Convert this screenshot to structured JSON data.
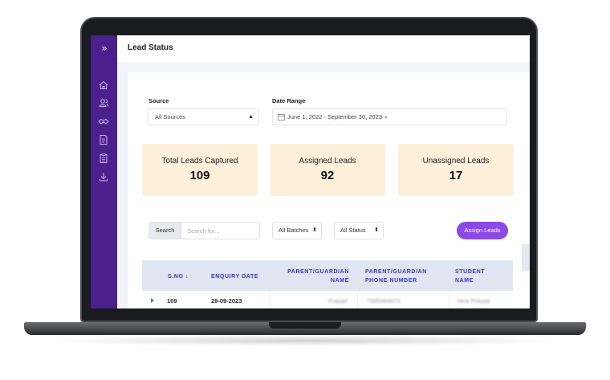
{
  "header": {
    "title": "Lead Status"
  },
  "filters": {
    "source_label": "Source",
    "source_value": "All Sources",
    "date_label": "Date Range",
    "date_value": "June 1, 2022 - September 30, 2023"
  },
  "stats": [
    {
      "label": "Total Leads Captured",
      "value": "109"
    },
    {
      "label": "Assigned Leads",
      "value": "92"
    },
    {
      "label": "Unassigned Leads",
      "value": "17"
    }
  ],
  "toolbar": {
    "search_label": "Search",
    "search_placeholder": "Search for...",
    "batch_select": "All Batches",
    "status_select": "All Status",
    "assign_label": "Assign Leads"
  },
  "table": {
    "headers": {
      "sno": "S.NO",
      "enquiry_date": "ENQUIRY DATE",
      "parent_name_1": "PARENT/GUARDIAN",
      "parent_name_2": "NAME",
      "parent_phone_1": "PARENT/GUARDIAN",
      "parent_phone_2": "PHONE NUMBER",
      "student_1": "STUDENT",
      "student_2": "NAME"
    },
    "rows": [
      {
        "sno": "109",
        "date": "29-09-2023",
        "parent": "Prasad",
        "phone": "7585464673",
        "student": "Vara Prasad"
      }
    ]
  },
  "colors": {
    "sidebar": "#4b1f8c",
    "accent": "#8b4ae6",
    "stat_bg": "#fdf0da",
    "table_head": "#dfe6f1"
  },
  "icons": [
    "sidebar-expand-icon",
    "home-icon",
    "users-icon",
    "handshake-icon",
    "document-icon",
    "clipboard-icon",
    "download-icon",
    "calendar-icon",
    "sort-down-icon",
    "expand-row-icon"
  ]
}
